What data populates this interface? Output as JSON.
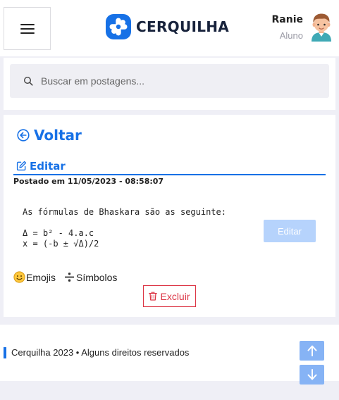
{
  "header": {
    "brand": "CERQUILHA",
    "user": {
      "name": "Ranie",
      "role": "Aluno"
    }
  },
  "search": {
    "placeholder": "Buscar em postagens..."
  },
  "post": {
    "back_label": "Voltar",
    "edit_tab_label": "Editar",
    "posted_at": "Postado em 11/05/2023 - 08:58:07",
    "content_lines": [
      "As fórmulas de Bhaskara são as seguinte:",
      "",
      "Δ = b² - 4.a.c",
      "x = (-b ± √Δ)/2"
    ],
    "edit_button_label": "Editar",
    "tools": {
      "emojis_label": "Emojis",
      "symbols_label": "Símbolos"
    },
    "delete_button_label": "Excluir"
  },
  "footer": {
    "text": "Cerquilha 2023 • Alguns direitos reservados"
  },
  "colors": {
    "accent": "#1771e6",
    "danger": "#dc3545",
    "disabled_button": "#b6d3fc",
    "scroll_button": "#86b3f5"
  },
  "icons": [
    "menu-icon",
    "cerquilha-logo-icon",
    "avatar",
    "search-icon",
    "arrow-left-circle-icon",
    "edit-square-icon",
    "emoji-smile-icon",
    "divide-icon",
    "trash-icon",
    "arrow-up-icon",
    "arrow-down-icon"
  ]
}
